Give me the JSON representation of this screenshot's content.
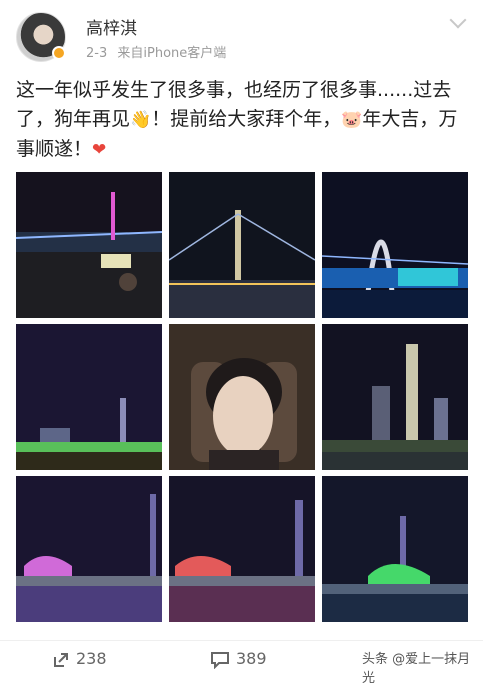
{
  "author": {
    "name": "高梓淇",
    "date": "2-3",
    "source": "来自iPhone客户端"
  },
  "post": {
    "text_segments": [
      "这一年似乎发生了很多事，也经历了很多事......过去了，狗年再见",
      "👋",
      "！提前给大家拜个年，",
      "🐷",
      "年大吉，万事顺遂！",
      "❤"
    ]
  },
  "icons": {
    "header": [
      "avatar",
      "verified-badge-icon",
      "chevron-down-icon"
    ],
    "actions": [
      "share-icon",
      "comment-icon"
    ]
  },
  "photos": [
    "night-bridge-photo-1",
    "night-bridge-tower-photo",
    "lit-bridge-arch-photo",
    "skyline-night-photo-1",
    "selfie-photo",
    "canton-tower-skyline-photo",
    "skyline-purple-light-photo",
    "skyline-red-light-photo",
    "skyline-green-light-photo"
  ],
  "actions": {
    "share_count": "238",
    "comment_count": "389"
  },
  "watermark": "头条 @爱上一抹月光",
  "colors": {
    "verified": "#f5a623",
    "text": "#222222",
    "meta": "#9a9a9a"
  }
}
